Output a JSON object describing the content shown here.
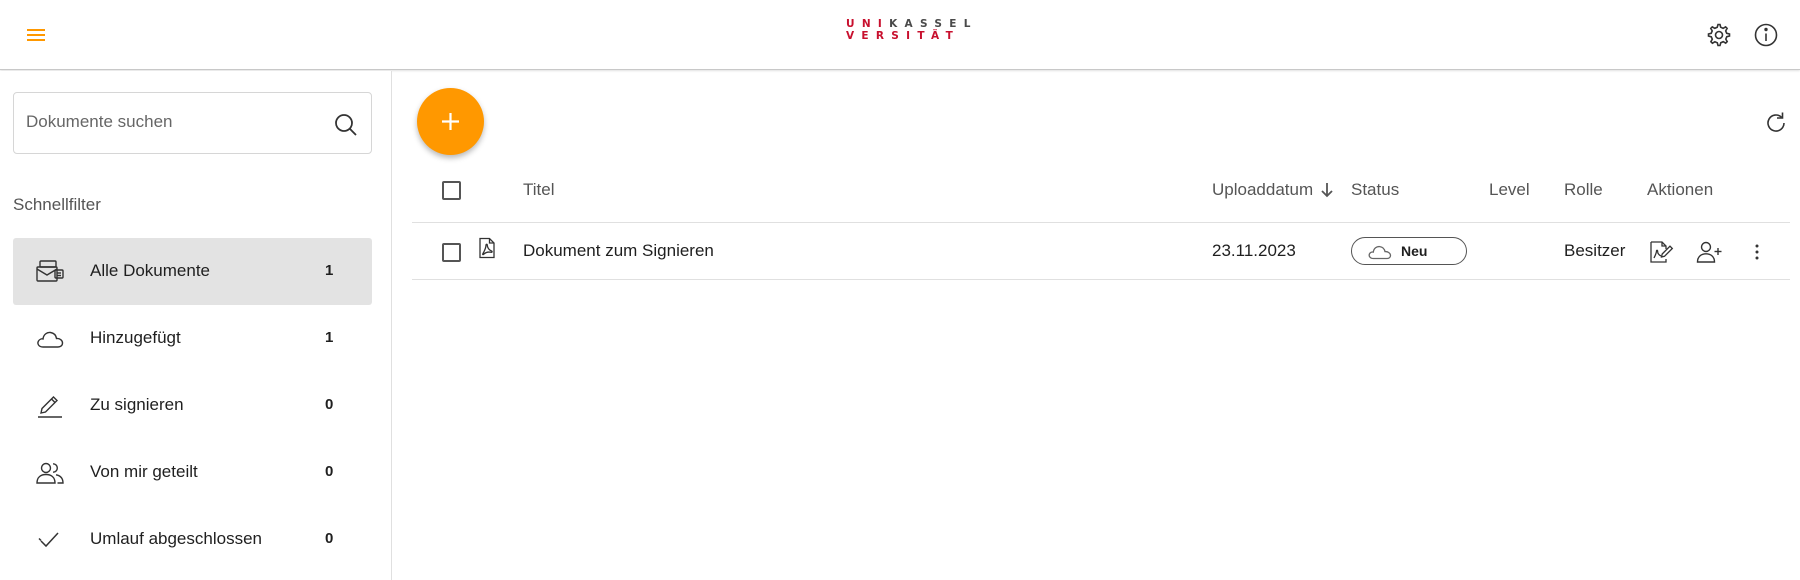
{
  "colors": {
    "accent": "#ff9800",
    "logo_pink": "#c8102e",
    "active_filter_bg": "#e3e3e3"
  },
  "header": {
    "menu_icon": "hamburger-menu-icon",
    "logo": {
      "line1_pink": "UNI",
      "line1_dark": "KASSEL",
      "line2_pink": "VERSITÄT"
    },
    "settings_icon": "gear-icon",
    "info_icon": "info-icon"
  },
  "sidebar": {
    "search": {
      "placeholder": "Dokumente suchen",
      "value": "",
      "icon": "search-icon"
    },
    "quickfilter_heading": "Schnellfilter",
    "items": [
      {
        "label": "Alle Dokumente",
        "count": "1",
        "icon": "documents-inbox-icon",
        "active": true
      },
      {
        "label": "Hinzugefügt",
        "count": "1",
        "icon": "cloud-icon",
        "active": false
      },
      {
        "label": "Zu signieren",
        "count": "0",
        "icon": "pen-icon",
        "active": false
      },
      {
        "label": "Von mir geteilt",
        "count": "0",
        "icon": "people-icon",
        "active": false
      },
      {
        "label": "Umlauf abgeschlossen",
        "count": "0",
        "icon": "double-check-icon",
        "active": false
      }
    ]
  },
  "main": {
    "add_button_icon": "plus-icon",
    "refresh_icon": "refresh-icon",
    "table": {
      "columns": {
        "title": "Titel",
        "upload_date": "Uploaddatum",
        "status": "Status",
        "level": "Level",
        "role": "Rolle",
        "actions": "Aktionen"
      },
      "sort": {
        "column": "upload_date",
        "direction": "descending",
        "icon": "arrow-down-icon"
      },
      "rows": [
        {
          "file_icon": "pdf-file-icon",
          "title": "Dokument zum Signieren",
          "upload_date": "23.11.2023",
          "status": "Neu",
          "status_icon": "cloud-icon",
          "level": "",
          "role": "Besitzer",
          "actions": [
            "sign-document-icon",
            "add-user-icon",
            "more-vertical-icon"
          ]
        }
      ]
    }
  }
}
